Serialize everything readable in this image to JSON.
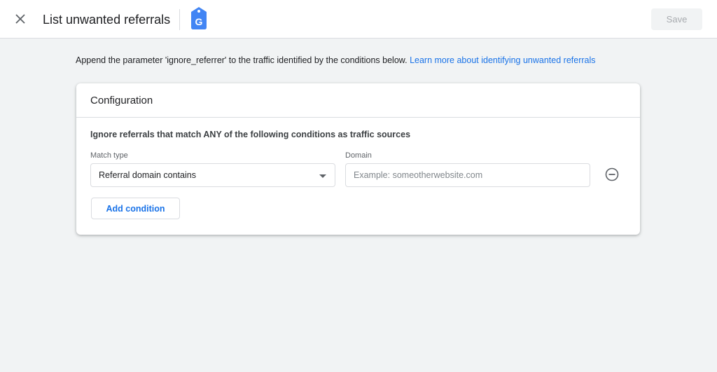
{
  "header": {
    "title": "List unwanted referrals",
    "save_label": "Save",
    "colors": {
      "tag_icon": "#4285f4",
      "link": "#1a73e8"
    }
  },
  "intro": {
    "text": "Append the parameter 'ignore_referrer' to the traffic identified by the conditions below.",
    "link": "Learn more about identifying unwanted referrals"
  },
  "configuration": {
    "title": "Configuration",
    "condition_title": "Ignore referrals that match ANY of the following conditions as traffic sources",
    "match_type_label": "Match type",
    "match_type_value": "Referral domain contains",
    "domain_label": "Domain",
    "domain_value": "",
    "domain_placeholder": "Example: someotherwebsite.com",
    "add_condition_label": "Add condition"
  },
  "icons": {
    "close": "close-icon",
    "tag": "google-tag-icon",
    "remove": "remove-circle-icon",
    "dropdown": "chevron-down-icon"
  }
}
